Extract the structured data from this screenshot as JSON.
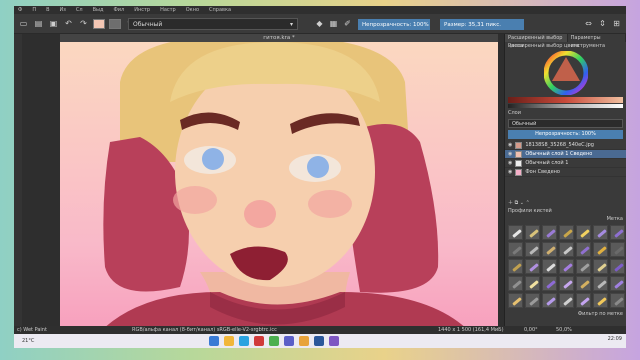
{
  "app": {
    "menu": [
      "Ф",
      "П",
      "В",
      "Из",
      "Сл",
      "Выд",
      "Фил",
      "Инстр",
      "Настр",
      "Окно",
      "Справка"
    ]
  },
  "toolbar": {
    "blend_mode": "Обычный",
    "opacity_label": "Непрозрачность: 100%",
    "size_label": "Размер: 35,31 пикс.",
    "fg_color": "#f3c6b4"
  },
  "document": {
    "title": "гитоя.kra *"
  },
  "dock": {
    "tabs": [
      "Расширенный выбор цвета",
      "Параметры инструмента"
    ],
    "color_section_title": "Расширенный выбор цвета",
    "layers_title": "Слои",
    "layer_blend": "Обычный",
    "layer_opacity": "Непрозрачность: 100%",
    "layers": [
      {
        "name": "18138S8_35268_540eC.jpg",
        "selected": false
      },
      {
        "name": "Обычный слой 1 Сведено",
        "selected": true
      },
      {
        "name": "Обычный слой 1",
        "selected": false
      },
      {
        "name": "Фон Сведено",
        "selected": false
      }
    ],
    "brush_presets_title": "Профили кистей",
    "brush_tag": "Метка",
    "brush_filter": "Фильтр по метке",
    "brush_colors": [
      "#e6e6e6",
      "#d8c27a",
      "#9a7bd6",
      "#c9a64a",
      "#f0d060",
      "#a58be0",
      "#8e6fd1",
      "#7a7a7a",
      "#b9b9b9",
      "#d0b070",
      "#c8c8c8",
      "#9070d0",
      "#e0b040",
      "#6a6a6a",
      "#c0a050",
      "#b090e0",
      "#dcdcdc",
      "#a47de0",
      "#a0a0a0",
      "#e0d090",
      "#7c5cc8",
      "#909090",
      "#f0e0a0",
      "#8d6ad6",
      "#c7a7ef",
      "#d4b060",
      "#b8b8b8",
      "#a080e0",
      "#e6c070",
      "#9b9b9b",
      "#b59aea",
      "#d0d0d0",
      "#c4a4f0",
      "#f1c85a",
      "#8a8a8a"
    ]
  },
  "status": {
    "brush": "c) Wet Paint",
    "color_profile": "RGB/альфа канал (8-бит/канал)  sRGB-elle-V2-srgbtrc.icc",
    "size": "1440 x 1 500 (161,4 МиБ)",
    "rotation": "0,00°",
    "zoom": "50,0%"
  },
  "taskbar": {
    "weather": "21°C",
    "time": "22:09",
    "date": "...",
    "icon_colors": [
      "#3a7bd5",
      "#f1b63a",
      "#2aa3e0",
      "#d03a3a",
      "#4caf50",
      "#5b5fc7",
      "#e8a33a",
      "#2b579a",
      "#7e57c2"
    ]
  }
}
